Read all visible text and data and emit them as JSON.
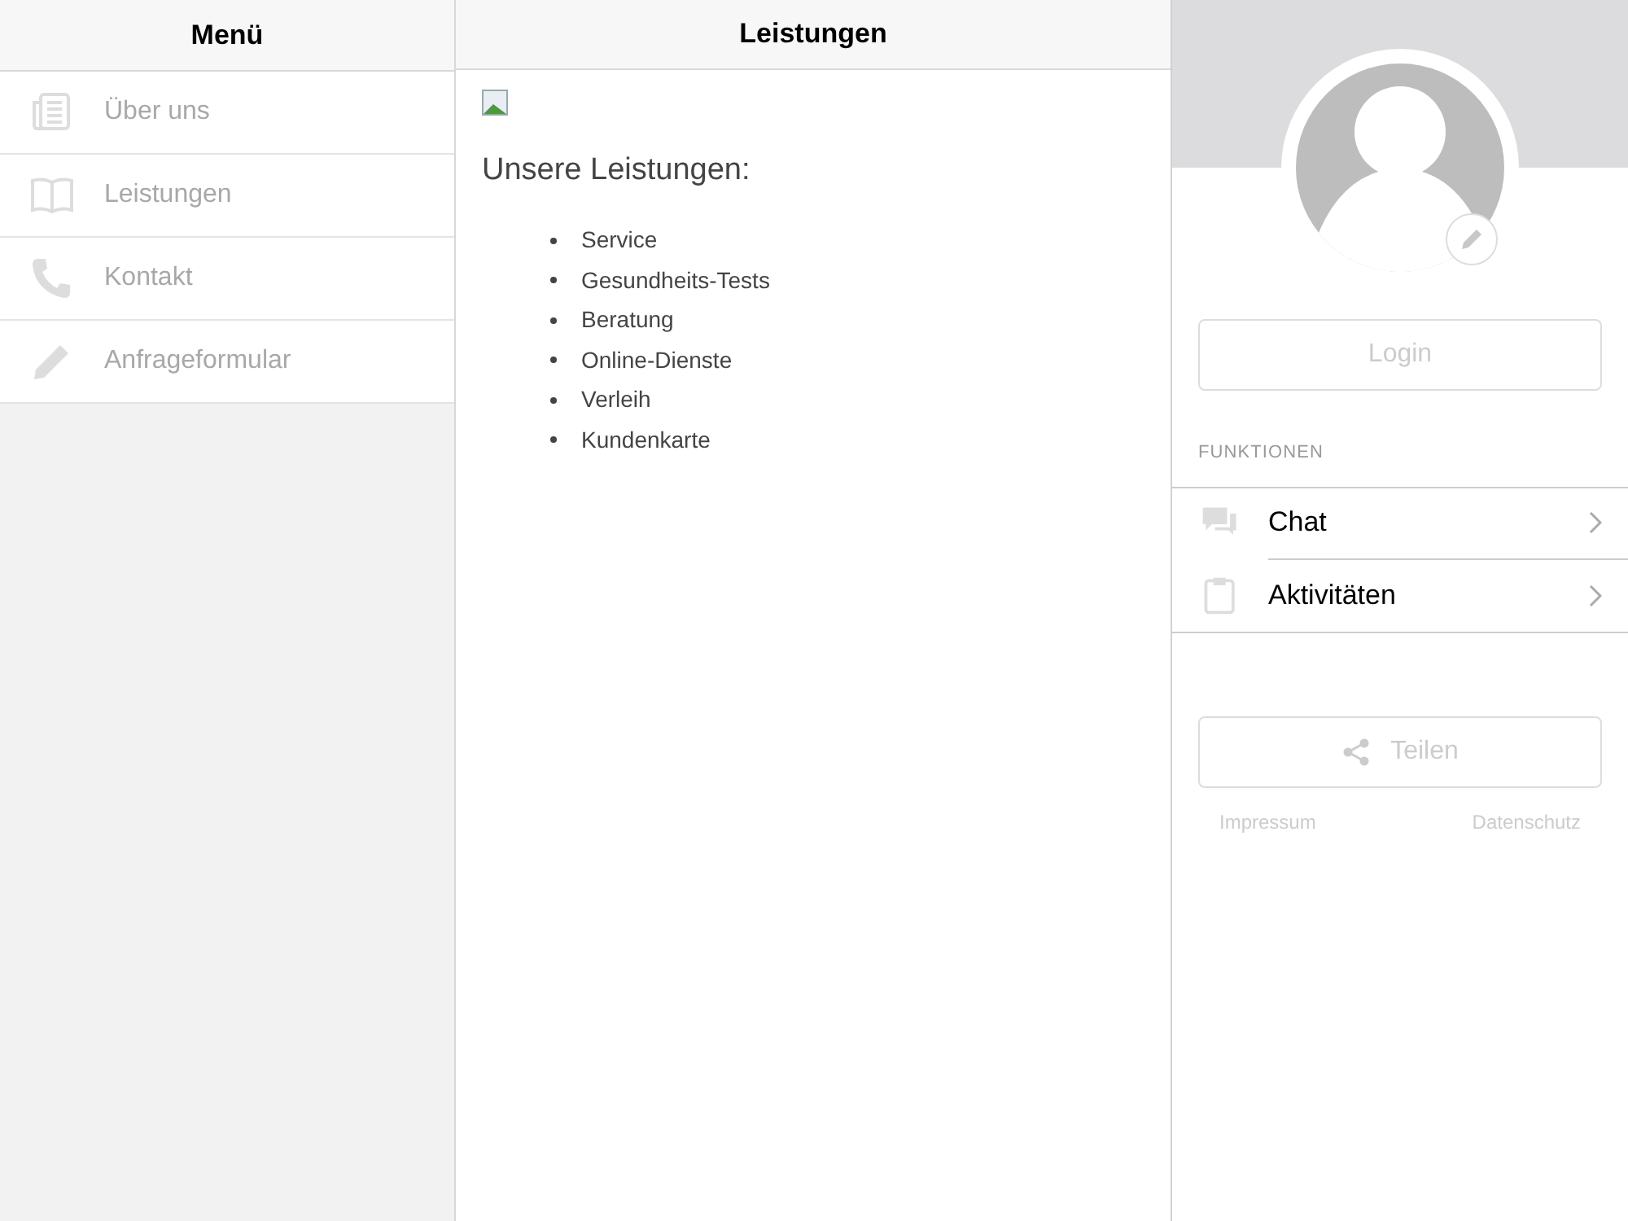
{
  "menu": {
    "title": "Menü",
    "items": [
      {
        "kind": "newspaper",
        "label": "Über uns"
      },
      {
        "kind": "book",
        "label": "Leistungen"
      },
      {
        "kind": "phone",
        "label": "Kontakt"
      },
      {
        "kind": "pencil",
        "label": "Anfrageformular"
      }
    ]
  },
  "content": {
    "title": "Leistungen",
    "heading": "Unsere Leistungen:",
    "list": [
      "Service",
      "Gesundheits-Tests",
      "Beratung",
      "Online-Dienste",
      "Verleih",
      "Kundenkarte"
    ]
  },
  "profile": {
    "login_button": "Login",
    "section_title": "FUNKTIONEN",
    "functions": [
      {
        "kind": "chat",
        "label": "Chat"
      },
      {
        "kind": "clipboard",
        "label": "Aktivitäten"
      }
    ],
    "share_button": "Teilen",
    "footer_links": [
      "Impressum",
      "Datenschutz"
    ]
  }
}
